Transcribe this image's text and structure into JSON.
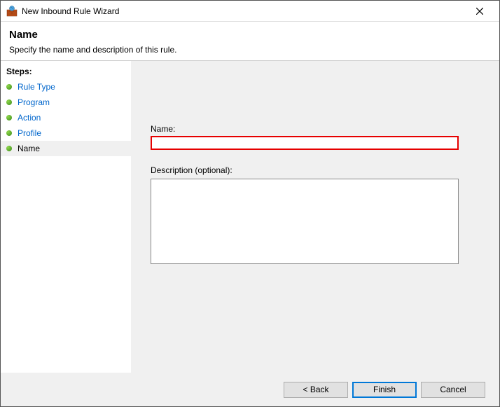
{
  "window": {
    "title": "New Inbound Rule Wizard"
  },
  "header": {
    "heading": "Name",
    "subheading": "Specify the name and description of this rule."
  },
  "sidebar": {
    "title": "Steps:",
    "items": [
      {
        "label": "Rule Type"
      },
      {
        "label": "Program"
      },
      {
        "label": "Action"
      },
      {
        "label": "Profile"
      },
      {
        "label": "Name"
      }
    ]
  },
  "form": {
    "name_label": "Name:",
    "name_value": "",
    "desc_label": "Description (optional):",
    "desc_value": ""
  },
  "buttons": {
    "back": "< Back",
    "finish": "Finish",
    "cancel": "Cancel"
  }
}
